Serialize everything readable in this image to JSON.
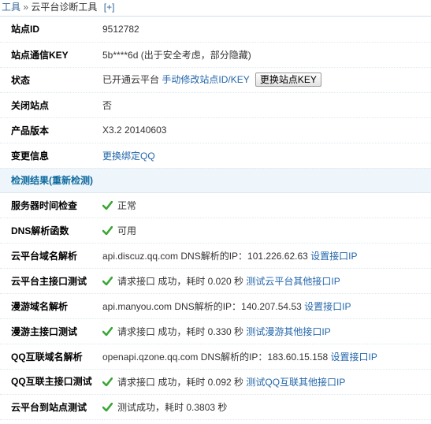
{
  "breadcrumb": {
    "root": "工具",
    "separator": "»",
    "current": "云平台诊断工具",
    "add": "[+]"
  },
  "info": [
    {
      "label": "站点ID",
      "value": "9512782"
    },
    {
      "label": "站点通信KEY",
      "value": "5b****6d (出于安全考虑，部分隐藏)"
    },
    {
      "label": "状态",
      "value": "已开通云平台",
      "link": "手动修改站点ID/KEY",
      "button": "更换站点KEY"
    },
    {
      "label": "关闭站点",
      "value": "否"
    },
    {
      "label": "产品版本",
      "value": "X3.2 20140603"
    },
    {
      "label": "变更信息",
      "link": "更换绑定QQ"
    }
  ],
  "check_header": {
    "title": "检测结果",
    "recheck": "(重新检测)"
  },
  "checks": [
    {
      "label": "服务器时间检查",
      "ok": true,
      "text": "正常"
    },
    {
      "label": "DNS解析函数",
      "ok": true,
      "text": "可用"
    },
    {
      "label": "云平台域名解析",
      "text": "api.discuz.qq.com DNS解析的IP：101.226.62.63",
      "link": "设置接口IP"
    },
    {
      "label": "云平台主接口测试",
      "ok": true,
      "text": "请求接口 成功，耗时 0.020 秒",
      "link": "测试云平台其他接口IP"
    },
    {
      "label": "漫游域名解析",
      "text": "api.manyou.com DNS解析的IP：140.207.54.53",
      "link": "设置接口IP"
    },
    {
      "label": "漫游主接口测试",
      "ok": true,
      "text": "请求接口 成功，耗时 0.330 秒",
      "link": "测试漫游其他接口IP"
    },
    {
      "label": "QQ互联域名解析",
      "text": "openapi.qzone.qq.com DNS解析的IP：183.60.15.158",
      "link": "设置接口IP"
    },
    {
      "label": "QQ互联主接口测试",
      "ok": true,
      "text": "请求接口 成功，耗时 0.092 秒",
      "link": "测试QQ互联其他接口IP"
    },
    {
      "label": "云平台到站点测试",
      "ok": true,
      "text": "测试成功，耗时 0.3803 秒"
    }
  ],
  "colors": {
    "link": "#2266aa",
    "check": "#3aa634",
    "header_bg": "#eef5fb"
  }
}
